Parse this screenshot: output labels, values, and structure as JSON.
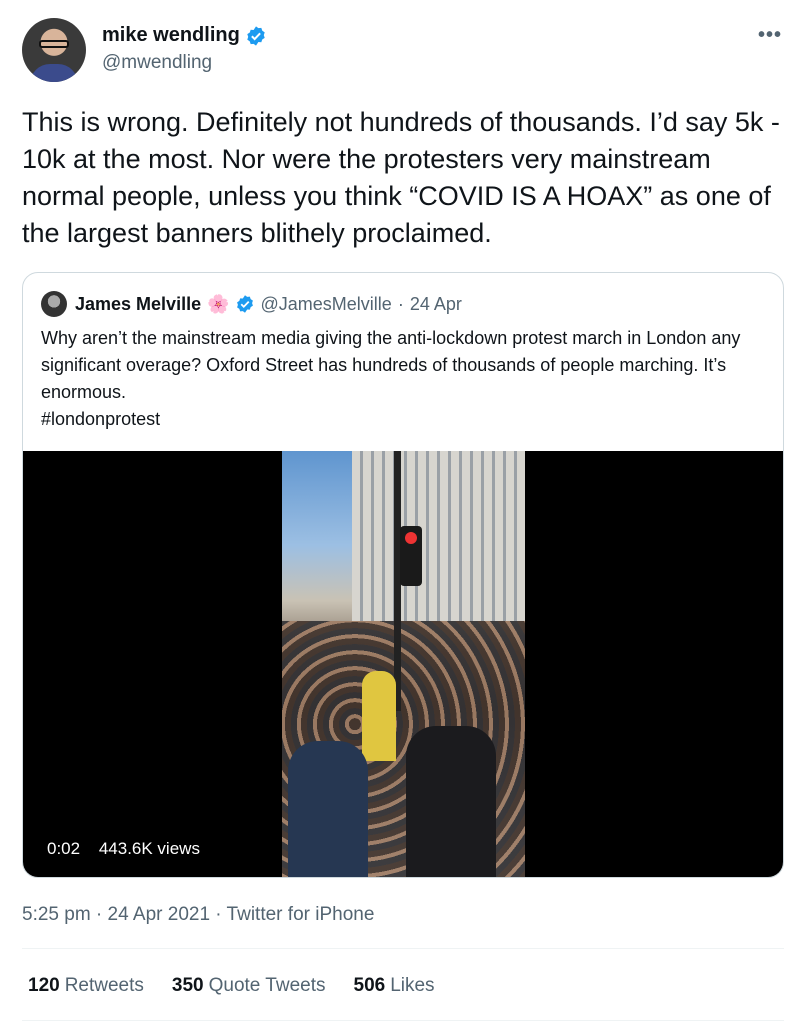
{
  "author": {
    "display_name": "mike wendling",
    "handle": "@mwendling",
    "verified": true,
    "more_icon": "more-horizontal-icon"
  },
  "tweet": {
    "text": "This is wrong. Definitely not hundreds of thousands. I’d say 5k - 10k at the most. Nor were the protesters very mainstream normal people, unless you think “COVID IS A HOAX” as one of the largest banners blithely proclaimed."
  },
  "quote": {
    "display_name": "James Melville",
    "emoji": "🌸",
    "verified": true,
    "handle": "@JamesMelville",
    "separator": "·",
    "date": "24 Apr",
    "text": "Why aren’t the mainstream media giving the anti-lockdown protest march in London any significant overage? Oxford Street has hundreds of thousands of people marching. It’s enormous.\n#londonprotest",
    "video": {
      "duration": "0:02",
      "views": "443.6K views"
    }
  },
  "meta": {
    "timestamp": "5:25 pm · 24 Apr 2021 · Twitter for iPhone"
  },
  "stats": {
    "retweets_count": "120",
    "retweets_label": "Retweets",
    "quotes_count": "350",
    "quotes_label": "Quote Tweets",
    "likes_count": "506",
    "likes_label": "Likes"
  },
  "colors": {
    "verified_blue": "#1d9bf0",
    "secondary_text": "#536471",
    "border": "#cfd9de"
  }
}
